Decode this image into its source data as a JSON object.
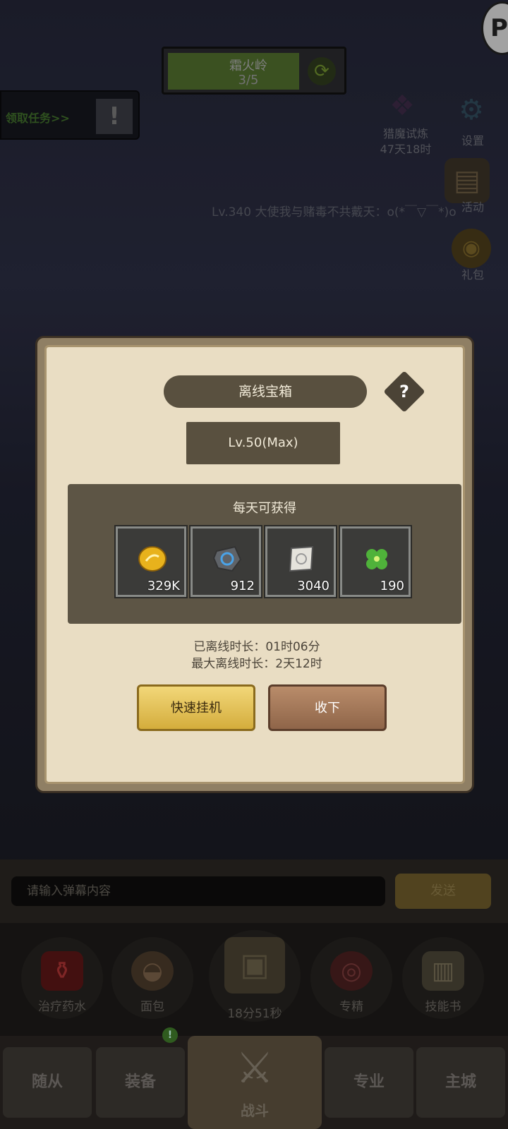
{
  "stage": {
    "name": "霜火岭",
    "progress": "3/5",
    "progress_fraction": 0.75
  },
  "quest": {
    "label": "领取任务>>"
  },
  "side_menu": [
    {
      "label": "猎魔试炼",
      "sub": "47天18时",
      "icon": "demon-wing-icon"
    },
    {
      "label": "设置",
      "icon": "gear-icon"
    },
    {
      "label": "活动",
      "icon": "scroll-board-icon"
    },
    {
      "label": "礼包",
      "icon": "gift-coin-icon"
    }
  ],
  "broadcast": "Lv.340 大使我与赌毒不共戴天：o(*￣▽￣*)o",
  "dialog": {
    "title": "离线宝箱",
    "help_label": "?",
    "level": "Lv.50(Max)",
    "rewards_title": "每天可获得",
    "rewards": [
      {
        "icon": "gold-coin-icon",
        "value": "329K"
      },
      {
        "icon": "blue-rune-stone-icon",
        "value": "912"
      },
      {
        "icon": "scroll-icon",
        "value": "3040"
      },
      {
        "icon": "clover-icon",
        "value": "190"
      }
    ],
    "offline_time": "已离线时长：01时06分",
    "max_offline_time": "最大离线时长：2天12时",
    "buttons": {
      "quick": "快速挂机",
      "collect": "收下"
    }
  },
  "chat": {
    "placeholder": "请输入弹幕内容",
    "send": "发送"
  },
  "quick_items": [
    {
      "label": "治疗药水",
      "icon": "potion-icon"
    },
    {
      "label": "面包",
      "icon": "bread-icon"
    },
    {
      "label": "18分51秒",
      "icon": "treasure-chest-icon"
    },
    {
      "label": "专精",
      "icon": "mastery-icon"
    },
    {
      "label": "技能书",
      "icon": "skill-book-icon"
    }
  ],
  "tabs": [
    {
      "label": "随从"
    },
    {
      "label": "装备",
      "badge": "!"
    },
    {
      "label": "战斗",
      "icon": "crossed-swords-icon"
    },
    {
      "label": "专业"
    },
    {
      "label": "主城"
    }
  ],
  "colors": {
    "dialog_bg": "#e9ddc3",
    "panel": "#59503f",
    "quick_btn": "#e6c25a",
    "collect_btn": "#a67b5b"
  }
}
